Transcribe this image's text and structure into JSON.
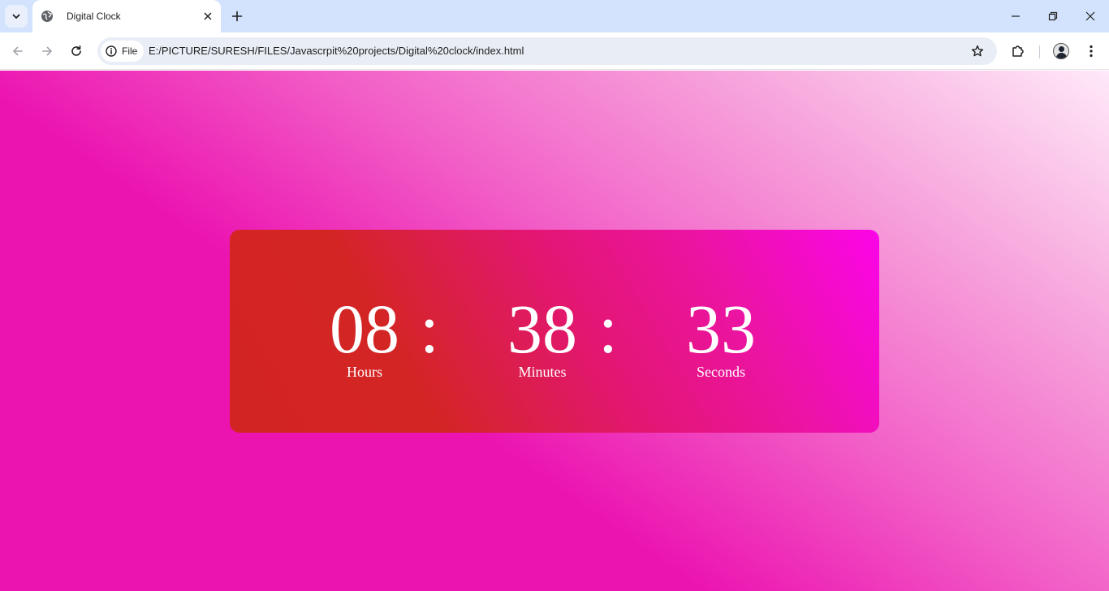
{
  "browser": {
    "tab": {
      "title": "Digital Clock",
      "favicon": "globe-icon"
    },
    "toolbar": {
      "site_info_label": "File",
      "url": "E:/PICTURE/SURESH/FILES/Javascrpit%20projects/Digital%20clock/index.html"
    },
    "icons": {
      "tab_search": "chevron-down-icon",
      "close_tab": "close-icon",
      "new_tab": "plus-icon",
      "back": "arrow-left-icon",
      "forward": "arrow-right-icon",
      "reload": "reload-icon",
      "site_info": "info-icon",
      "bookmark": "star-icon",
      "extensions": "puzzle-icon",
      "profile": "avatar-icon",
      "menu": "kebab-menu-icon",
      "minimize": "minimize-icon",
      "restore": "restore-icon",
      "close_window": "close-icon"
    }
  },
  "clock": {
    "hours": {
      "value": "08",
      "label": "Hours"
    },
    "minutes": {
      "value": "38",
      "label": "Minutes"
    },
    "seconds": {
      "value": "33",
      "label": "Seconds"
    },
    "separator": ":"
  },
  "colors": {
    "page_gradient": [
      "#ec14b1",
      "#f25fc7",
      "#ffe9f8"
    ],
    "card_gradient": [
      "#d32424",
      "#e31674",
      "#fb05e8"
    ],
    "text": "#ffffff",
    "titlebar": "#d3e3fd"
  }
}
